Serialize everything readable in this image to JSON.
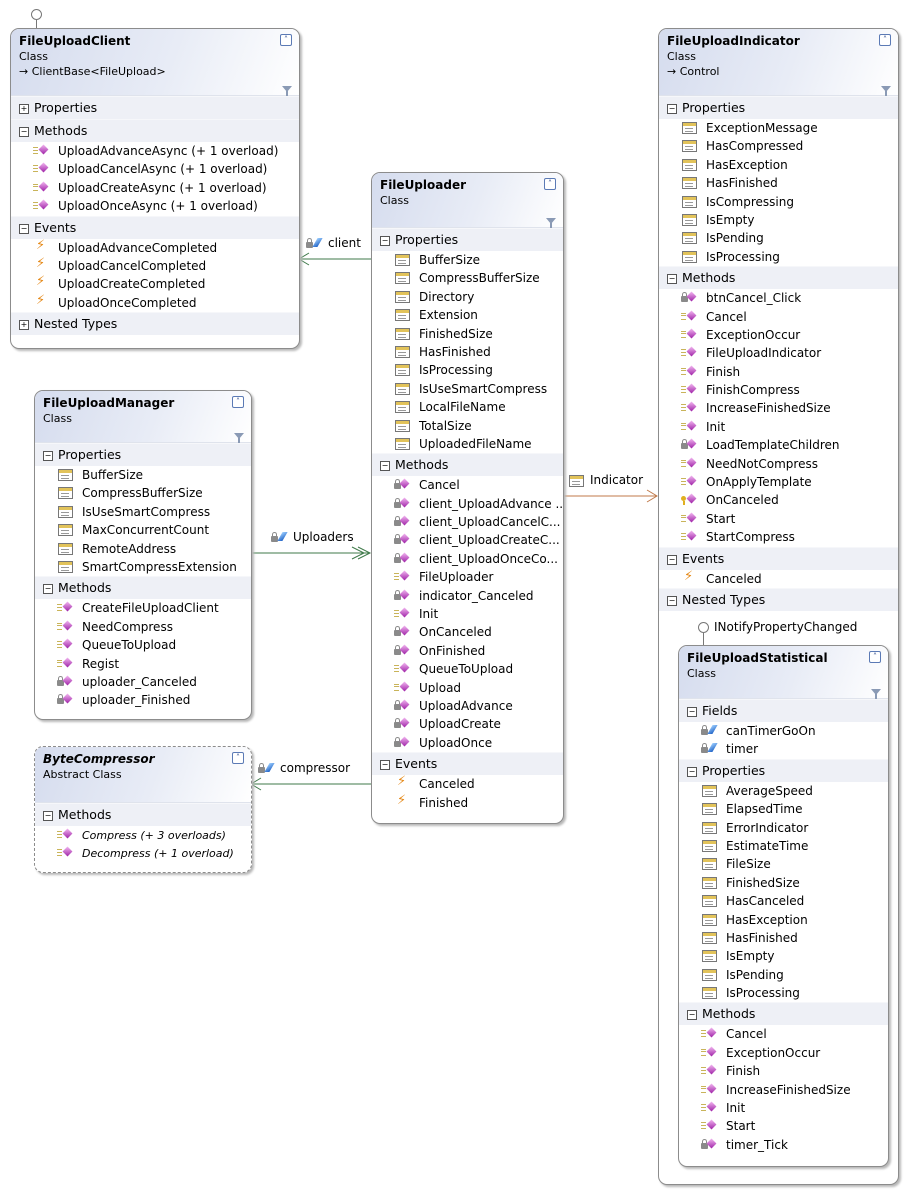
{
  "classes": [
    {
      "key": "client",
      "name": "FileUploadClient",
      "kind": "Class",
      "base": "ClientBase<FileUpload>",
      "abstract": false,
      "filter": true,
      "interface": "",
      "sections": [
        {
          "title": "Properties",
          "collapsed": true,
          "items": []
        },
        {
          "title": "Methods",
          "collapsed": false,
          "items": [
            {
              "name": "UploadAdvanceAsync (+ 1 overload)",
              "icon": "method-public"
            },
            {
              "name": "UploadCancelAsync (+ 1 overload)",
              "icon": "method-public"
            },
            {
              "name": "UploadCreateAsync (+ 1 overload)",
              "icon": "method-public"
            },
            {
              "name": "UploadOnceAsync (+ 1 overload)",
              "icon": "method-public"
            }
          ]
        },
        {
          "title": "Events",
          "collapsed": false,
          "items": [
            {
              "name": "UploadAdvanceCompleted",
              "icon": "event"
            },
            {
              "name": "UploadCancelCompleted",
              "icon": "event"
            },
            {
              "name": "UploadCreateCompleted",
              "icon": "event"
            },
            {
              "name": "UploadOnceCompleted",
              "icon": "event"
            }
          ]
        },
        {
          "title": "Nested Types",
          "collapsed": true,
          "items": []
        }
      ]
    },
    {
      "key": "uploader",
      "name": "FileUploader",
      "kind": "Class",
      "base": "",
      "abstract": false,
      "filter": true,
      "interface": "",
      "sections": [
        {
          "title": "Properties",
          "collapsed": false,
          "items": [
            {
              "name": "BufferSize",
              "icon": "property"
            },
            {
              "name": "CompressBufferSize",
              "icon": "property"
            },
            {
              "name": "Directory",
              "icon": "property"
            },
            {
              "name": "Extension",
              "icon": "property"
            },
            {
              "name": "FinishedSize",
              "icon": "property"
            },
            {
              "name": "HasFinished",
              "icon": "property"
            },
            {
              "name": "IsProcessing",
              "icon": "property"
            },
            {
              "name": "IsUseSmartCompress",
              "icon": "property"
            },
            {
              "name": "LocalFileName",
              "icon": "property"
            },
            {
              "name": "TotalSize",
              "icon": "property"
            },
            {
              "name": "UploadedFileName",
              "icon": "property"
            }
          ]
        },
        {
          "title": "Methods",
          "collapsed": false,
          "items": [
            {
              "name": "Cancel",
              "icon": "method-private"
            },
            {
              "name": "client_UploadAdvance ...",
              "icon": "method-private"
            },
            {
              "name": "client_UploadCancelC...",
              "icon": "method-private"
            },
            {
              "name": "client_UploadCreateC...",
              "icon": "method-private"
            },
            {
              "name": "client_UploadOnceCo...",
              "icon": "method-private"
            },
            {
              "name": "FileUploader",
              "icon": "method-public"
            },
            {
              "name": "indicator_Canceled",
              "icon": "method-private"
            },
            {
              "name": "Init",
              "icon": "method-public"
            },
            {
              "name": "OnCanceled",
              "icon": "method-private"
            },
            {
              "name": "OnFinished",
              "icon": "method-private"
            },
            {
              "name": "QueueToUpload",
              "icon": "method-public"
            },
            {
              "name": "Upload",
              "icon": "method-public"
            },
            {
              "name": "UploadAdvance",
              "icon": "method-private"
            },
            {
              "name": "UploadCreate",
              "icon": "method-private"
            },
            {
              "name": "UploadOnce",
              "icon": "method-private"
            }
          ]
        },
        {
          "title": "Events",
          "collapsed": false,
          "items": [
            {
              "name": "Canceled",
              "icon": "event"
            },
            {
              "name": "Finished",
              "icon": "event"
            }
          ]
        }
      ]
    },
    {
      "key": "indicator",
      "name": "FileUploadIndicator",
      "kind": "Class",
      "base": "Control",
      "abstract": false,
      "filter": true,
      "interface": "",
      "sections": [
        {
          "title": "Properties",
          "collapsed": false,
          "items": [
            {
              "name": "ExceptionMessage",
              "icon": "property"
            },
            {
              "name": "HasCompressed",
              "icon": "property"
            },
            {
              "name": "HasException",
              "icon": "property"
            },
            {
              "name": "HasFinished",
              "icon": "property"
            },
            {
              "name": "IsCompressing",
              "icon": "property"
            },
            {
              "name": "IsEmpty",
              "icon": "property"
            },
            {
              "name": "IsPending",
              "icon": "property"
            },
            {
              "name": "IsProcessing",
              "icon": "property"
            }
          ]
        },
        {
          "title": "Methods",
          "collapsed": false,
          "items": [
            {
              "name": "btnCancel_Click",
              "icon": "method-private"
            },
            {
              "name": "Cancel",
              "icon": "method-public"
            },
            {
              "name": "ExceptionOccur",
              "icon": "method-public"
            },
            {
              "name": "FileUploadIndicator",
              "icon": "method-public"
            },
            {
              "name": "Finish",
              "icon": "method-public"
            },
            {
              "name": "FinishCompress",
              "icon": "method-public"
            },
            {
              "name": "IncreaseFinishedSize",
              "icon": "method-public"
            },
            {
              "name": "Init",
              "icon": "method-public"
            },
            {
              "name": "LoadTemplateChildren",
              "icon": "method-private"
            },
            {
              "name": "NeedNotCompress",
              "icon": "method-public"
            },
            {
              "name": "OnApplyTemplate",
              "icon": "method-public"
            },
            {
              "name": "OnCanceled",
              "icon": "method-protected"
            },
            {
              "name": "Start",
              "icon": "method-public"
            },
            {
              "name": "StartCompress",
              "icon": "method-public"
            }
          ]
        },
        {
          "title": "Events",
          "collapsed": false,
          "items": [
            {
              "name": "Canceled",
              "icon": "event"
            }
          ]
        },
        {
          "title": "Nested Types",
          "collapsed": false,
          "items": []
        }
      ]
    },
    {
      "key": "statistical",
      "name": "FileUploadStatistical",
      "kind": "Class",
      "base": "",
      "abstract": false,
      "filter": true,
      "interface": "INotifyPropertyChanged",
      "sections": [
        {
          "title": "Fields",
          "collapsed": false,
          "items": [
            {
              "name": "canTimerGoOn",
              "icon": "field-private"
            },
            {
              "name": "timer",
              "icon": "field-private"
            }
          ]
        },
        {
          "title": "Properties",
          "collapsed": false,
          "items": [
            {
              "name": "AverageSpeed",
              "icon": "property"
            },
            {
              "name": "ElapsedTime",
              "icon": "property"
            },
            {
              "name": "ErrorIndicator",
              "icon": "property"
            },
            {
              "name": "EstimateTime",
              "icon": "property"
            },
            {
              "name": "FileSize",
              "icon": "property"
            },
            {
              "name": "FinishedSize",
              "icon": "property"
            },
            {
              "name": "HasCanceled",
              "icon": "property"
            },
            {
              "name": "HasException",
              "icon": "property"
            },
            {
              "name": "HasFinished",
              "icon": "property"
            },
            {
              "name": "IsEmpty",
              "icon": "property"
            },
            {
              "name": "IsPending",
              "icon": "property"
            },
            {
              "name": "IsProcessing",
              "icon": "property"
            }
          ]
        },
        {
          "title": "Methods",
          "collapsed": false,
          "items": [
            {
              "name": "Cancel",
              "icon": "method-public"
            },
            {
              "name": "ExceptionOccur",
              "icon": "method-public"
            },
            {
              "name": "Finish",
              "icon": "method-public"
            },
            {
              "name": "IncreaseFinishedSize",
              "icon": "method-public"
            },
            {
              "name": "Init",
              "icon": "method-public"
            },
            {
              "name": "Start",
              "icon": "method-public"
            },
            {
              "name": "timer_Tick",
              "icon": "method-private"
            }
          ]
        }
      ]
    },
    {
      "key": "manager",
      "name": "FileUploadManager",
      "kind": "Class",
      "base": "",
      "abstract": false,
      "filter": true,
      "interface": "",
      "sections": [
        {
          "title": "Properties",
          "collapsed": false,
          "items": [
            {
              "name": "BufferSize",
              "icon": "property"
            },
            {
              "name": "CompressBufferSize",
              "icon": "property"
            },
            {
              "name": "IsUseSmartCompress",
              "icon": "property"
            },
            {
              "name": "MaxConcurrentCount",
              "icon": "property"
            },
            {
              "name": "RemoteAddress",
              "icon": "property"
            },
            {
              "name": "SmartCompressExtension",
              "icon": "property"
            }
          ]
        },
        {
          "title": "Methods",
          "collapsed": false,
          "items": [
            {
              "name": "CreateFileUploadClient",
              "icon": "method-public"
            },
            {
              "name": "NeedCompress",
              "icon": "method-public"
            },
            {
              "name": "QueueToUpload",
              "icon": "method-public"
            },
            {
              "name": "Regist",
              "icon": "method-public"
            },
            {
              "name": "uploader_Canceled",
              "icon": "method-private"
            },
            {
              "name": "uploader_Finished",
              "icon": "method-private"
            }
          ]
        }
      ]
    },
    {
      "key": "compressor",
      "name": "ByteCompressor",
      "kind": "Abstract Class",
      "base": "",
      "abstract": true,
      "filter": false,
      "interface": "",
      "sections": [
        {
          "title": "Methods",
          "collapsed": false,
          "items": [
            {
              "name": "Compress (+ 3 overloads)",
              "icon": "method-public"
            },
            {
              "name": "Decompress (+ 1 overload)",
              "icon": "method-public"
            }
          ]
        }
      ]
    }
  ],
  "associations": {
    "client": "client",
    "uploaders": "Uploaders",
    "compressor": "compressor",
    "indicator": "Indicator"
  },
  "colors": {
    "association": "#3f7a4a",
    "indicator_association": "#c07a4a",
    "header_gradient": "#d5dcee",
    "section_band": "#eef0f6"
  }
}
